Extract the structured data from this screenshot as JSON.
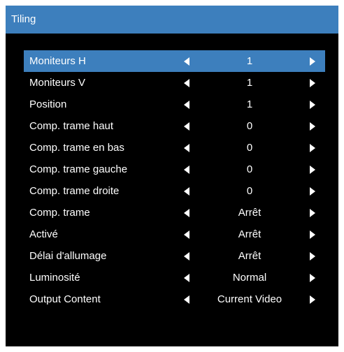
{
  "window": {
    "title": "Tiling"
  },
  "menu": {
    "items": [
      {
        "label": "Moniteurs H",
        "value": "1"
      },
      {
        "label": "Moniteurs V",
        "value": "1"
      },
      {
        "label": "Position",
        "value": "1"
      },
      {
        "label": "Comp. trame haut",
        "value": "0"
      },
      {
        "label": "Comp. trame en bas",
        "value": "0"
      },
      {
        "label": "Comp. trame gauche",
        "value": "0"
      },
      {
        "label": "Comp. trame droite",
        "value": "0"
      },
      {
        "label": "Comp. trame",
        "value": "Arrêt"
      },
      {
        "label": "Activé",
        "value": "Arrêt"
      },
      {
        "label": "Délai d'allumage",
        "value": "Arrêt"
      },
      {
        "label": "Luminosité",
        "value": "Normal"
      },
      {
        "label": "Output Content",
        "value": "Current Video"
      }
    ],
    "selected_index": 0
  },
  "colors": {
    "accent": "#3d7fbd",
    "background": "#000000",
    "text": "#ffffff"
  },
  "icons": {
    "decrease": "triangle-left-icon",
    "increase": "triangle-right-icon"
  }
}
